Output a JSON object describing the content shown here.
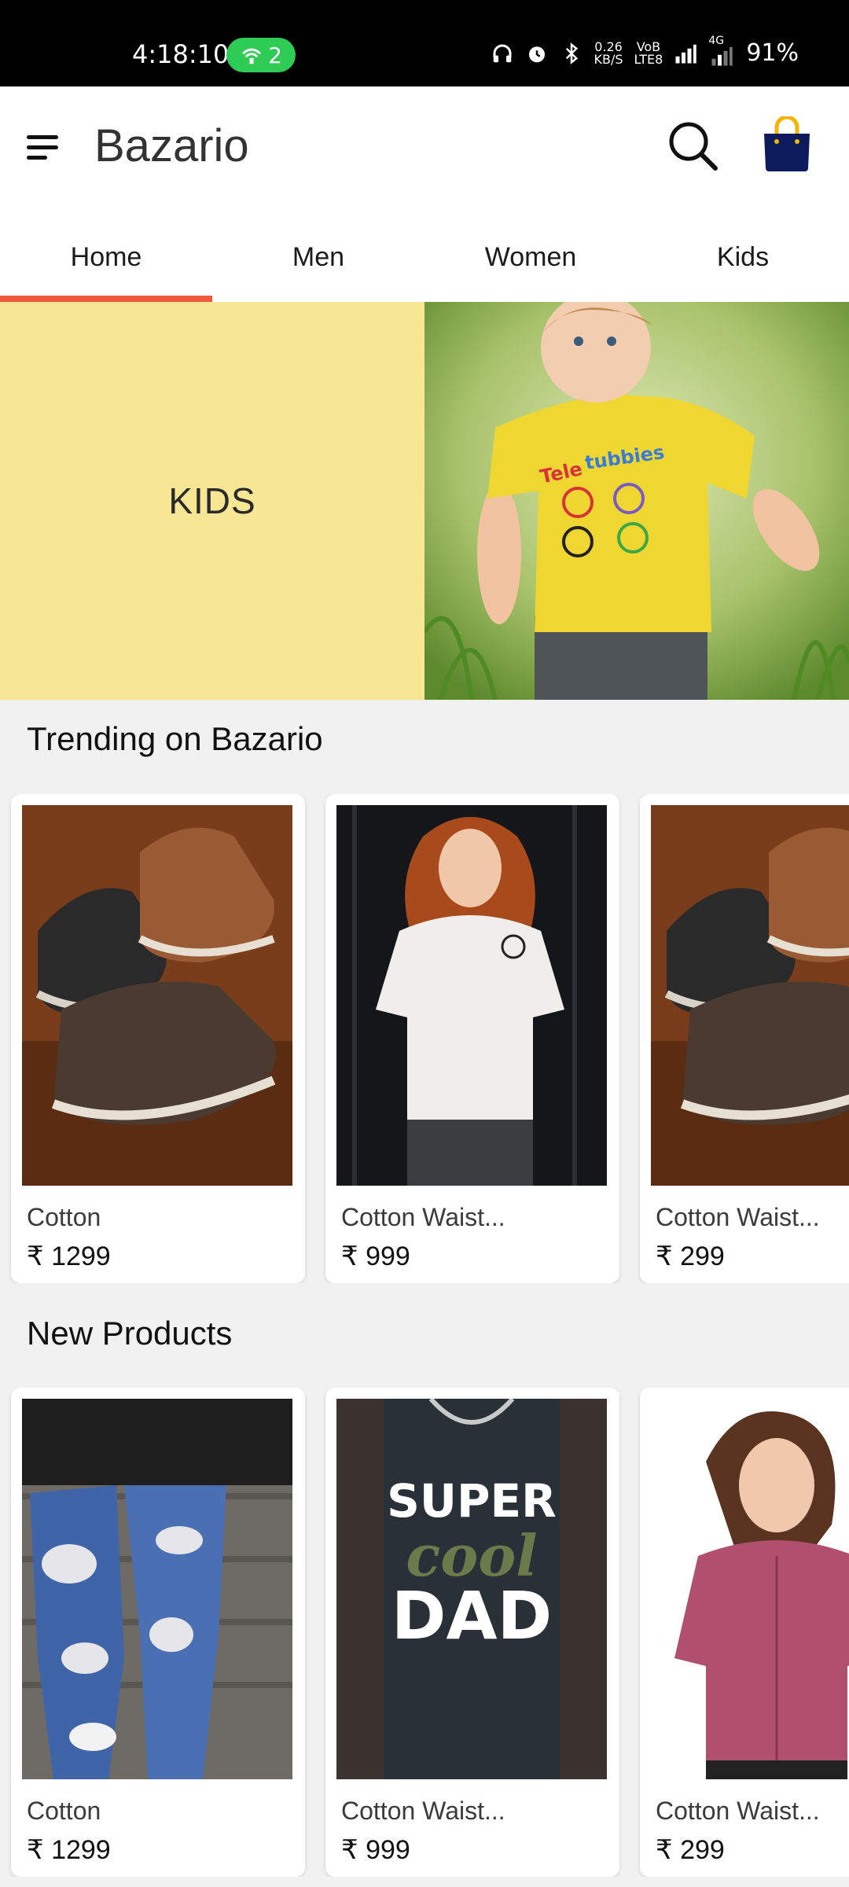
{
  "status_bar": {
    "time": "4:18:10",
    "hotspot_count": "2",
    "net_speed_top": "0.26",
    "net_speed_bottom": "KB/S",
    "volte_top": "VoB",
    "volte_bottom": "LTE8",
    "network_type": "4G",
    "battery": "91%"
  },
  "app_bar": {
    "title": "Bazario",
    "icons": [
      "menu-icon",
      "search-icon",
      "shopping-bag-icon"
    ],
    "bag_color": "#0d1a5c",
    "bag_handle_color": "#f4b400"
  },
  "tabs": [
    {
      "label": "Home",
      "active": true
    },
    {
      "label": "Men",
      "active": false
    },
    {
      "label": "Women",
      "active": false
    },
    {
      "label": "Kids",
      "active": false
    }
  ],
  "accent_color": "#ef5a3e",
  "banner": {
    "label": "KIDS",
    "background": "#f7e694"
  },
  "trending": {
    "title": "Trending on Bazario",
    "items": [
      {
        "name": "Cotton",
        "price": "₹ 1299",
        "image": "sneakers-photo"
      },
      {
        "name": "Cotton Waist...",
        "price": "₹ 999",
        "image": "white-tshirt-photo"
      },
      {
        "name": "Cotton Waist...",
        "price": "₹ 299",
        "image": "sneakers-photo"
      }
    ]
  },
  "new_products": {
    "title": "New Products",
    "items": [
      {
        "name": "Cotton",
        "price": "₹ 1299",
        "image": "ripped-jeans-photo"
      },
      {
        "name": "Cotton Waist...",
        "price": "₹ 999",
        "image": "super-cool-dad-tshirt-photo",
        "print_text": [
          "SUPER",
          "cool",
          "DAD"
        ]
      },
      {
        "name": "Cotton Waist...",
        "price": "₹ 299",
        "image": "pink-blouse-photo"
      }
    ]
  }
}
